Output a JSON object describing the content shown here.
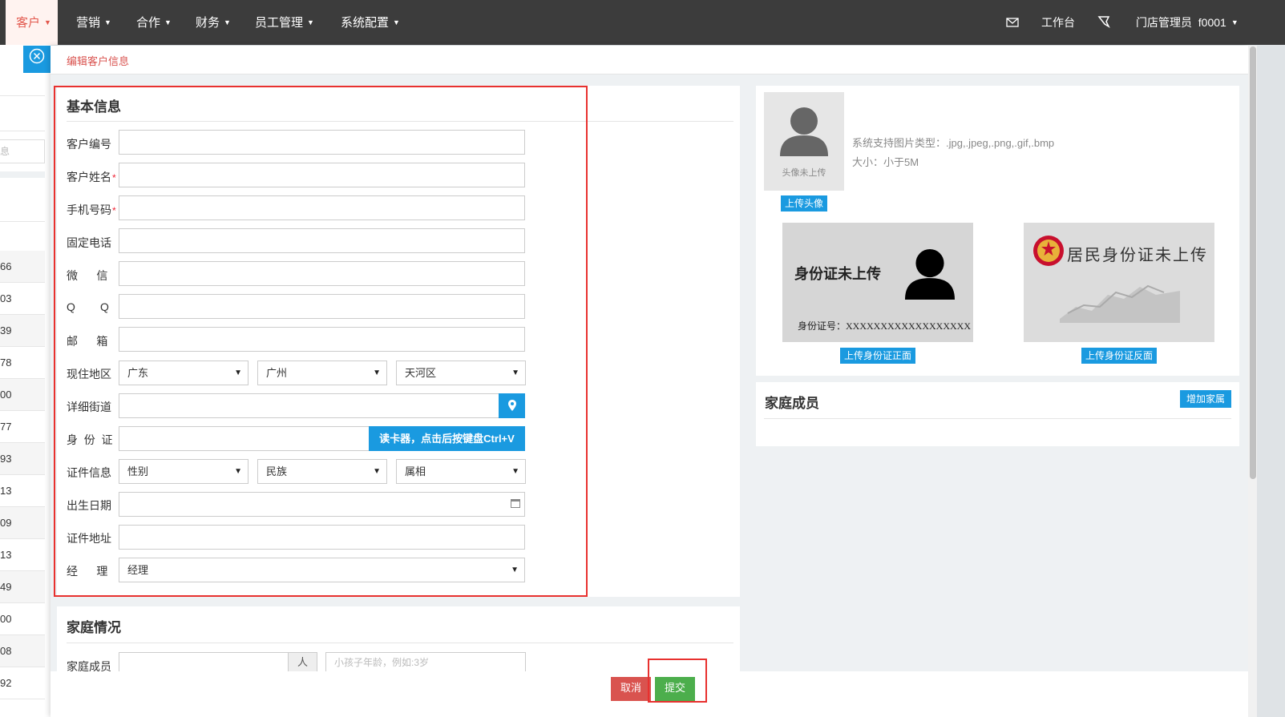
{
  "nav": {
    "items": [
      {
        "label": "客户",
        "active": true
      },
      {
        "label": "营销"
      },
      {
        "label": "合作"
      },
      {
        "label": "财务"
      },
      {
        "label": "员工管理"
      },
      {
        "label": "系统配置"
      }
    ],
    "workbench": "工作台",
    "user": "门店管理员  f0001"
  },
  "left_list": {
    "partial_placeholder": "息",
    "rows": [
      "66",
      "03",
      "39",
      "78",
      "00",
      "77",
      "93",
      "13",
      "09",
      "13",
      "49",
      "00",
      "08",
      "92"
    ]
  },
  "breadcrumb": "编辑客户信息",
  "basic": {
    "title": "基本信息",
    "fields": {
      "customer_no": {
        "label": "客户编号",
        "value": ""
      },
      "customer_name": {
        "label": "客户姓名",
        "value": "",
        "required": "*"
      },
      "mobile": {
        "label": "手机号码",
        "value": "",
        "required": "*"
      },
      "phone": {
        "label": "固定电话",
        "value": ""
      },
      "wechat": {
        "label": "微      信",
        "value": ""
      },
      "qq": {
        "label": "Q        Q",
        "value": ""
      },
      "email": {
        "label": "邮      箱",
        "value": ""
      },
      "region": {
        "label": "现住地区",
        "province": "广东",
        "city": "广州",
        "district": "天河区"
      },
      "street": {
        "label": "详细街道",
        "value": ""
      },
      "idcard": {
        "label": "身  份  证",
        "value": "",
        "reader_button": "读卡器，点击后按键盘Ctrl+V"
      },
      "cert_info": {
        "label": "证件信息",
        "gender": "性别",
        "ethnicity": "民族",
        "zodiac": "属相"
      },
      "birthday": {
        "label": "出生日期",
        "value": ""
      },
      "cert_address": {
        "label": "证件地址",
        "value": ""
      },
      "manager": {
        "label": "经      理",
        "value": "经理"
      }
    }
  },
  "family": {
    "title": "家庭情况",
    "member_label": "家庭成员",
    "unit": "人",
    "child_age_placeholder": "小孩子年龄，例如:3岁"
  },
  "avatar": {
    "placeholder": "头像未上传",
    "upload_button": "上传头像",
    "supported_types": "系统支持图片类型：.jpg,.jpeg,.png,.gif,.bmp",
    "size_limit": "大小：小于5M"
  },
  "idcard_front": {
    "title": "身份证未上传",
    "id_label": "身份证号：XXXXXXXXXXXXXXXXXX",
    "upload_button": "上传身份证正面"
  },
  "idcard_back": {
    "title": "居民身份证未上传",
    "upload_button": "上传身份证反面"
  },
  "family_members": {
    "title": "家庭成员",
    "add_button": "增加家属"
  },
  "actions": {
    "cancel": "取消",
    "submit": "提交"
  },
  "colors": {
    "accent_blue": "#1a9ae0",
    "danger": "#d9534f",
    "success": "#4cae4c",
    "nav_bg": "#3c3c3c",
    "highlight_red": "#e8312f"
  }
}
